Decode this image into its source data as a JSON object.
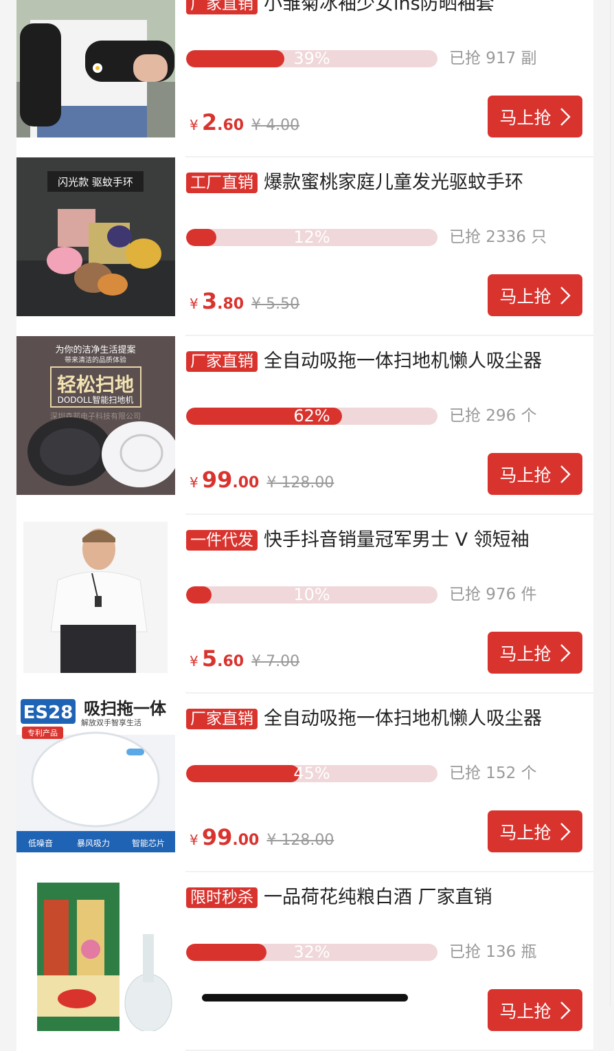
{
  "products": [
    {
      "tag": "厂家直销",
      "title": "小雏菊冰袖少女ins防晒袖套",
      "progress_text": "39%",
      "progress": 0.39,
      "sold": "已抢 917 副",
      "currency": "¥",
      "price_int": "2",
      "price_dec": ".60",
      "orig_price": "¥ 4.00",
      "buy_label": "马上抢",
      "image": "sleeve-photo"
    },
    {
      "tag": "工厂直销",
      "title": "爆款蜜桃家庭儿童发光驱蚊手环",
      "progress_text": "12%",
      "progress": 0.12,
      "sold": "已抢 2336 只",
      "currency": "¥",
      "price_int": "3",
      "price_dec": ".80",
      "orig_price": "¥ 5.50",
      "buy_label": "马上抢",
      "image": "bracelet-photo",
      "image_caption": "闪光款 驱蚊手环"
    },
    {
      "tag": "厂家直销",
      "title": "全自动吸拖一体扫地机懒人吸尘器",
      "progress_text": "62%",
      "progress": 0.62,
      "sold": "已抢 296 个",
      "currency": "¥",
      "price_int": "99",
      "price_dec": ".00",
      "orig_price": "¥ 128.00",
      "buy_label": "马上抢",
      "image": "robot-vacuum-dark-photo",
      "image_caption": "为你的洁净生活提案",
      "image_sub": "带来清洁的品质体验",
      "image_headline": "轻松扫地",
      "image_model": "DODOLL智能扫地机",
      "image_company": "深圳森邦电子科技有限公司"
    },
    {
      "tag": "一件代发",
      "title": "快手抖音销量冠军男士 V 领短袖",
      "progress_text": "10%",
      "progress": 0.1,
      "sold": "已抢 976 件",
      "currency": "¥",
      "price_int": "5",
      "price_dec": ".60",
      "orig_price": "¥ 7.00",
      "buy_label": "马上抢",
      "image": "tshirt-model-photo"
    },
    {
      "tag": "厂家直销",
      "title": "全自动吸拖一体扫地机懒人吸尘器",
      "progress_text": "45%",
      "progress": 0.45,
      "sold": "已抢 152 个",
      "currency": "¥",
      "price_int": "99",
      "price_dec": ".00",
      "orig_price": "¥ 128.00",
      "buy_label": "马上抢",
      "image": "robot-vacuum-white-photo",
      "image_model": "ES28",
      "image_headline": "吸扫拖一体",
      "image_sub": "解放双手智享生活",
      "image_badge": "专利产品",
      "image_features": [
        "低噪音",
        "暴风吸力",
        "智能芯片"
      ]
    },
    {
      "tag": "限时秒杀",
      "title": "一品荷花纯粮白酒 厂家直销",
      "progress_text": "32%",
      "progress": 0.32,
      "sold": "已抢 136 瓶",
      "currency": "¥",
      "price_int": "",
      "price_dec": "",
      "orig_price": "",
      "buy_label": "马上抢",
      "image": "baijiu-box-photo"
    }
  ],
  "colors": {
    "accent": "#d9332e",
    "progress_track": "#f0d7d9",
    "muted_text": "#999999"
  },
  "icons": {
    "buy": "chevron-right-icon"
  }
}
